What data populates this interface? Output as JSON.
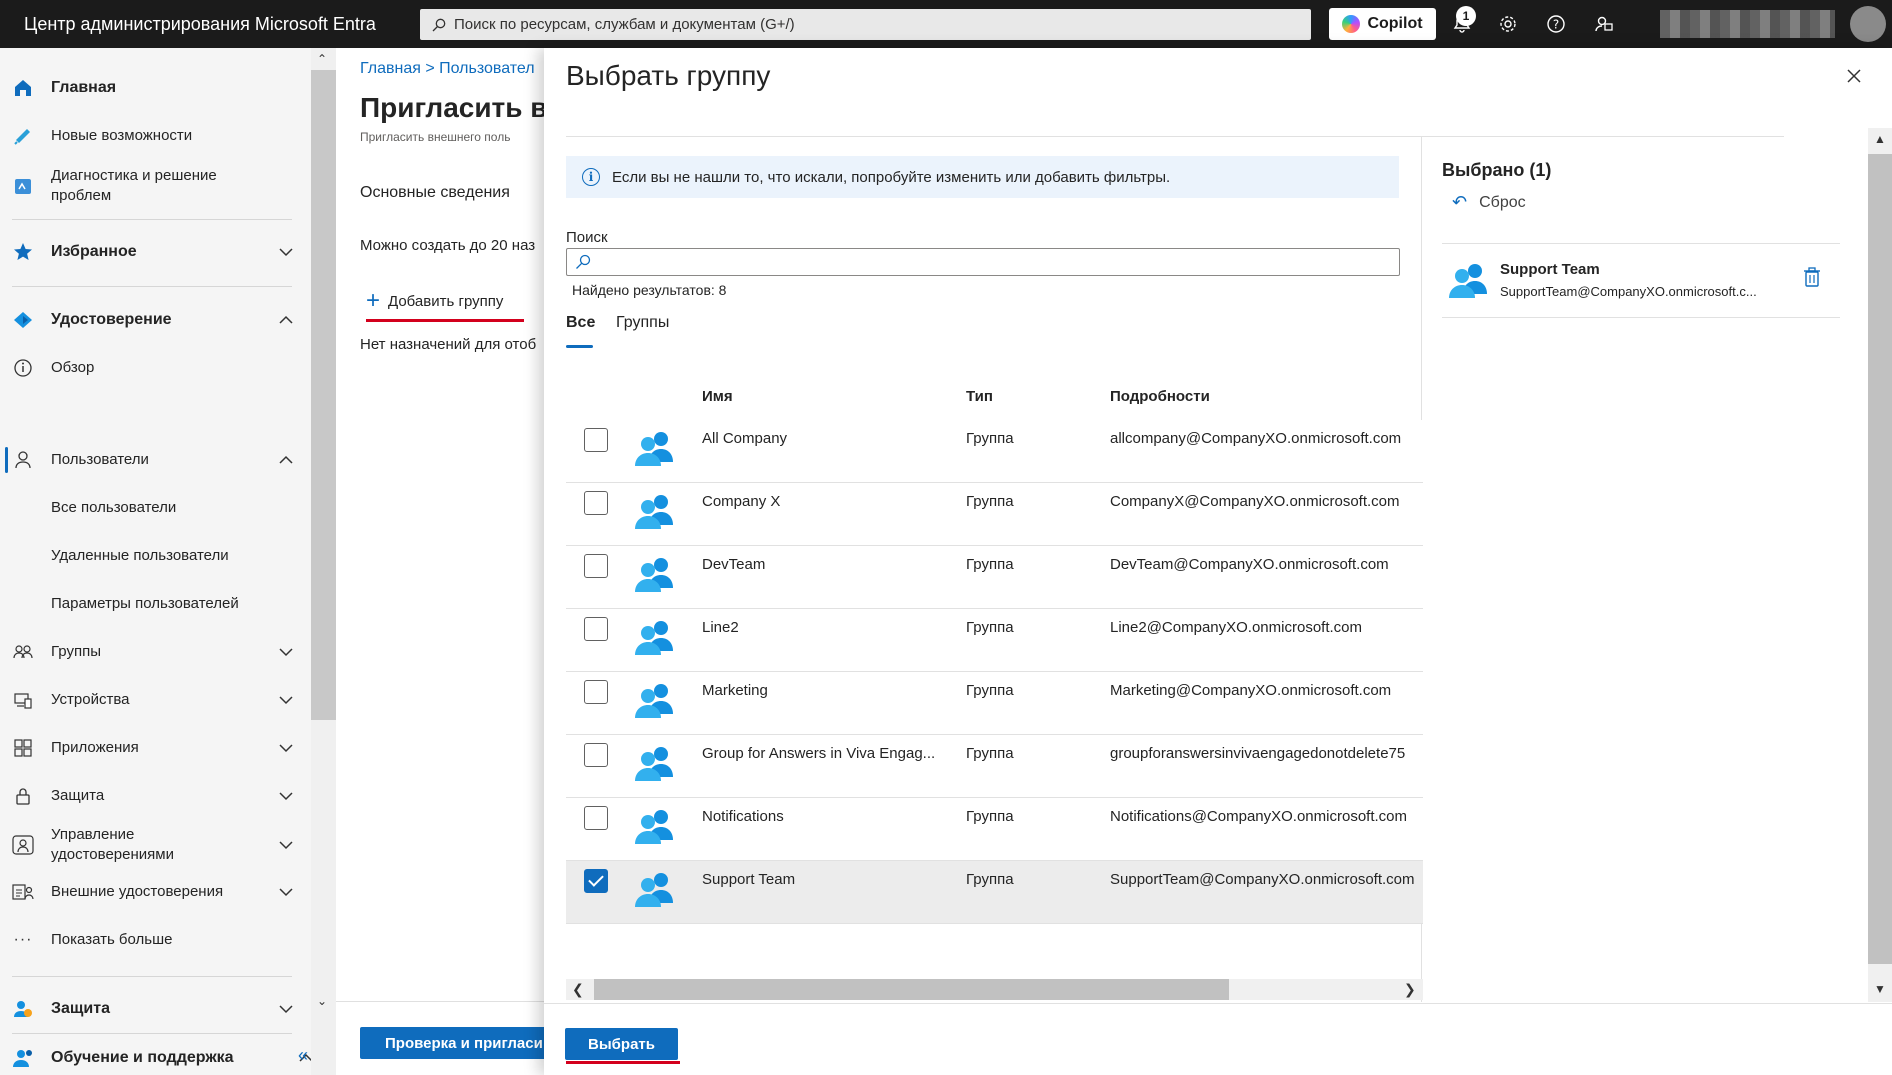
{
  "topbar": {
    "brand": "Центр администрирования Microsoft Entra",
    "search_placeholder": "Поиск по ресурсам, службам и документам (G+/)",
    "copilot_label": "Copilot",
    "notification_count": "1",
    "icons": [
      "bell-icon",
      "gear-icon",
      "help-icon",
      "feedback-icon"
    ]
  },
  "leftnav": {
    "items": [
      {
        "label": "Главная",
        "icon": "home-icon"
      },
      {
        "label": "Новые возможности",
        "icon": "megaphone-icon"
      },
      {
        "label": "Диагностика и решение проблем",
        "icon": "diagnose-icon"
      },
      {
        "label": "Избранное",
        "icon": "star-icon"
      },
      {
        "label": "Удостоверение",
        "icon": "identity-icon"
      },
      {
        "label": "Обзор",
        "icon": "info-icon"
      },
      {
        "label": "Пользователи",
        "icon": "user-icon"
      },
      {
        "label": "Все пользователи"
      },
      {
        "label": "Удаленные пользователи"
      },
      {
        "label": "Параметры пользователей"
      },
      {
        "label": "Группы",
        "icon": "groups-icon"
      },
      {
        "label": "Устройства",
        "icon": "devices-icon"
      },
      {
        "label": "Приложения",
        "icon": "apps-icon"
      },
      {
        "label": "Защита",
        "icon": "lock-icon"
      },
      {
        "label": "Управление удостоверениями",
        "icon": "governance-icon"
      },
      {
        "label": "Внешние удостоверения",
        "icon": "external-icon"
      },
      {
        "label": "Показать больше",
        "icon": "more-icon"
      },
      {
        "label": "Защита",
        "icon": "protection-icon"
      },
      {
        "label": "Обучение и поддержка",
        "icon": "learning-icon"
      }
    ]
  },
  "bgpage": {
    "breadcrumb": "Главная  >  Пользовател",
    "title": "Пригласить в",
    "subtitle": "Пригласить внешнего поль",
    "section": "Основные сведения",
    "info": "Можно создать до 20 наз",
    "add_group": "Добавить группу",
    "no_assign": "Нет назначений для отоб",
    "review_button": "Проверка и пригласи"
  },
  "panel": {
    "title": "Выбрать группу",
    "info_text": "Если вы не нашли то, что искали, попробуйте изменить или добавить фильтры.",
    "search_label": "Поиск",
    "search_value": "",
    "results_text": "Найдено результатов: 8",
    "tabs": [
      "Все",
      "Группы"
    ],
    "columns": [
      "Имя",
      "Тип",
      "Подробности"
    ],
    "rows": [
      {
        "name": "All Company",
        "type": "Группа",
        "detail": "allcompany@CompanyXO.onmicrosoft.com",
        "checked": false
      },
      {
        "name": "Company X",
        "type": "Группа",
        "detail": "CompanyX@CompanyXO.onmicrosoft.com",
        "checked": false
      },
      {
        "name": "DevTeam",
        "type": "Группа",
        "detail": "DevTeam@CompanyXO.onmicrosoft.com",
        "checked": false
      },
      {
        "name": "Line2",
        "type": "Группа",
        "detail": "Line2@CompanyXO.onmicrosoft.com",
        "checked": false
      },
      {
        "name": "Marketing",
        "type": "Группа",
        "detail": "Marketing@CompanyXO.onmicrosoft.com",
        "checked": false
      },
      {
        "name": "Group for Answers in Viva Engag...",
        "type": "Группа",
        "detail": "groupforanswersinvivaengagedonotdelete75",
        "checked": false
      },
      {
        "name": "Notifications",
        "type": "Группа",
        "detail": "Notifications@CompanyXO.onmicrosoft.com",
        "checked": false
      },
      {
        "name": "Support Team",
        "type": "Группа",
        "detail": "SupportTeam@CompanyXO.onmicrosoft.com",
        "checked": true
      }
    ],
    "selected_title": "Выбрано (1)",
    "reset_label": "Сброс",
    "selected_item": {
      "name": "Support Team",
      "mail": "SupportTeam@CompanyXO.onmicrosoft.c..."
    },
    "select_button": "Выбрать"
  },
  "colors": {
    "accent": "#0f6cbd",
    "annotation_red": "#d3001d",
    "topbar": "#1b1b1b"
  }
}
